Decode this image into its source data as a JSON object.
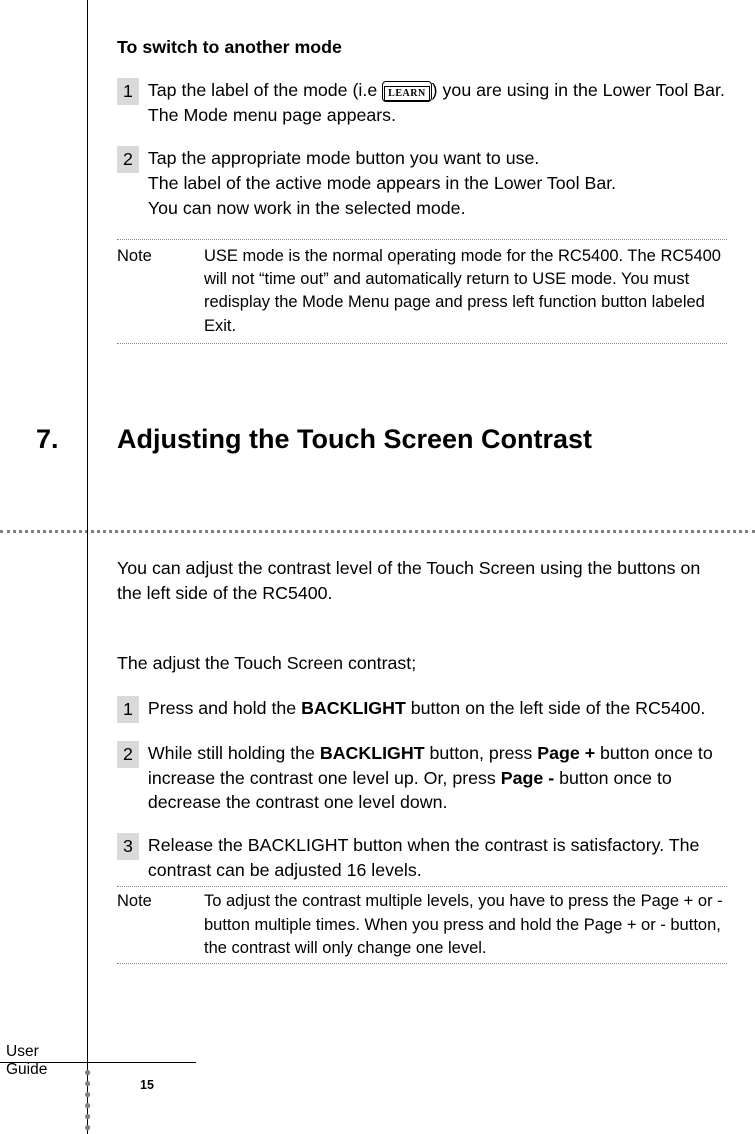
{
  "section1": {
    "subhead": "To switch to another mode",
    "steps": [
      {
        "num": "1",
        "pre": "Tap the label of the mode (i.e ",
        "badge": "LEARN",
        "post": ") you are using in the Lower Tool Bar.",
        "line2": "The Mode menu page appears."
      },
      {
        "num": "2",
        "text": "Tap the appropriate mode button you want to use.",
        "line2": "The label of the active mode appears in the Lower Tool Bar.",
        "line3": "You can now work in the selected mode."
      }
    ],
    "note": {
      "label": "Note",
      "body": "USE mode is the normal operating mode for  the RC5400. The RC5400 will not “time out” and automatically return to USE mode. You must redisplay the Mode Menu page and press left function button labeled Exit."
    }
  },
  "section2": {
    "num": "7.",
    "title": "Adjusting the Touch Screen Contrast",
    "intro": "You can adjust the contrast level of the Touch Screen using the buttons on the left side of the RC5400.",
    "lead": "The adjust the Touch Screen contrast;",
    "steps": [
      {
        "num": "1",
        "pre": "Press and hold the ",
        "b1": "BACKLIGHT",
        "post": " button on the left side of the RC5400."
      },
      {
        "num": "2",
        "pre": "While still holding the ",
        "b1": "BACKLIGHT",
        "mid1": " button, press ",
        "b2": "Page +",
        "mid2": " button once to increase the contrast one level up. Or, press ",
        "b3": "Page -",
        "post": " button once to decrease the contrast one level down."
      },
      {
        "num": "3",
        "text": "Release the BACKLIGHT button when the contrast is satisfactory. The contrast can be adjusted 16 levels."
      }
    ],
    "note": {
      "label": "Note",
      "body": "To adjust the contrast multiple levels, you have to press the Page + or - button multiple times. When you press and hold the Page + or - button, the contrast will only change one level."
    }
  },
  "footer": {
    "label": "User Guide",
    "page": "15"
  }
}
